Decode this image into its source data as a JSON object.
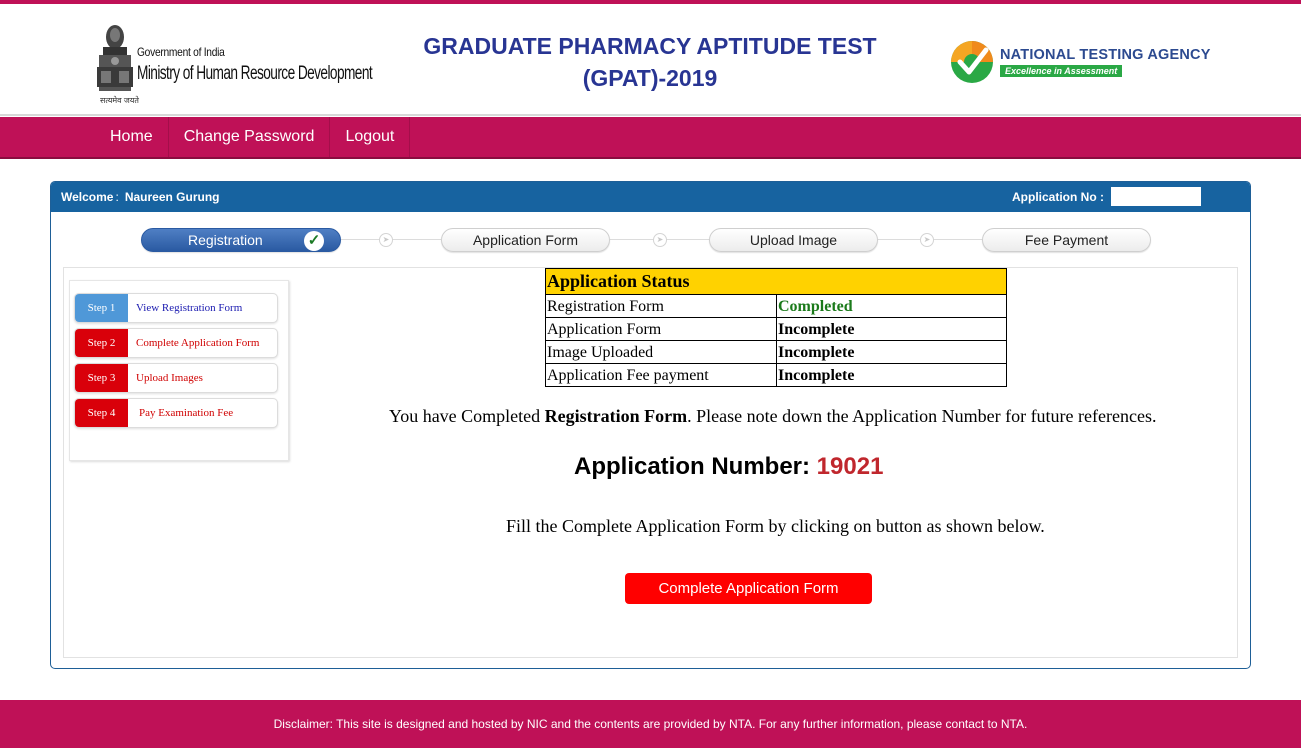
{
  "header": {
    "gov_line": "Government of India",
    "ministry_line": "Ministry of Human Resource Development",
    "motto": "सत्यमेव जयते",
    "title_line1": "GRADUATE PHARMACY APTITUDE TEST",
    "title_line2": "(GPAT)-2019",
    "nta_name": "NATIONAL TESTING AGENCY",
    "nta_tagline": "Excellence in Assessment"
  },
  "nav": {
    "items": [
      {
        "label": "Home"
      },
      {
        "label": "Change Password"
      },
      {
        "label": "Logout"
      }
    ]
  },
  "panel": {
    "welcome_label": "Welcome",
    "user_name": "Naureen Gurung",
    "application_no_label": "Application No"
  },
  "progress": {
    "steps": [
      {
        "label": "Registration",
        "done": true
      },
      {
        "label": "Application Form"
      },
      {
        "label": "Upload Image"
      },
      {
        "label": "Fee Payment"
      }
    ]
  },
  "sidebar": {
    "steps": [
      {
        "tag": "Step 1",
        "label": "View Registration Form",
        "state": "done"
      },
      {
        "tag": "Step 2",
        "label": "Complete Application Form",
        "state": "pending"
      },
      {
        "tag": "Step 3",
        "label": "Upload Images",
        "state": "pending"
      },
      {
        "tag": "Step 4",
        "label": "Pay Examination Fee",
        "state": "pending"
      }
    ]
  },
  "status": {
    "heading": "Application Status",
    "rows": [
      {
        "label": "Registration Form",
        "value": "Completed"
      },
      {
        "label": "Application Form",
        "value": "Incomplete"
      },
      {
        "label": "Image Uploaded",
        "value": "Incomplete"
      },
      {
        "label": "Application Fee payment",
        "value": "Incomplete"
      }
    ]
  },
  "message": {
    "part1": "You have Completed ",
    "part2": "Registration Form",
    "part3": ". Please note down the Application Number for future references.",
    "app_number_label": "Application Number: ",
    "app_number": "19021",
    "fill_note": "Fill the Complete Application Form by clicking on button as shown below.",
    "button_label": "Complete Application Form"
  },
  "footer": {
    "disclaimer": "Disclaimer: This site is designed and hosted by NIC and the contents are provided by NTA. For any further information, please contact to NTA."
  },
  "colors": {
    "brand": "#bf1157",
    "panel_header": "#1763a0",
    "status_header": "#ffd200",
    "completed": "#1b7a1b",
    "action_red": "#ff0000",
    "app_number": "#c0272d"
  }
}
